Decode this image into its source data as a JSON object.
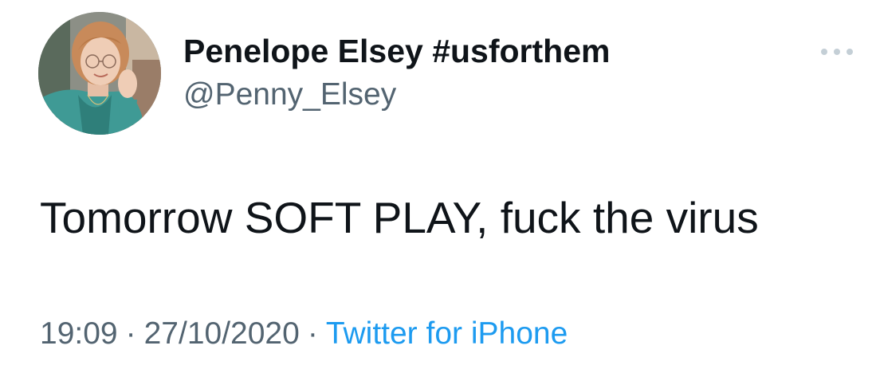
{
  "user": {
    "display_name": "Penelope Elsey #usforthem",
    "handle": "@Penny_Elsey",
    "avatar_icon": "profile-photo"
  },
  "tweet": {
    "text": "Tomorrow SOFT PLAY, fuck the virus",
    "time": "19:09",
    "separator": "·",
    "date": "27/10/2020",
    "source": "Twitter for iPhone"
  },
  "actions": {
    "more_icon": "more-dots-icon"
  },
  "colors": {
    "text": "#0f1419",
    "secondary": "#536471",
    "link": "#1d9bf0",
    "background": "#ffffff"
  }
}
